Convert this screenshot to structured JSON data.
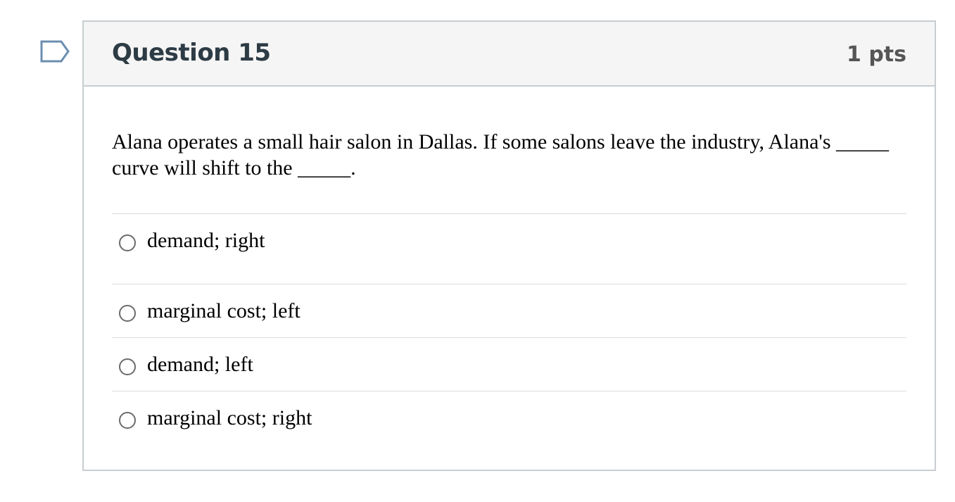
{
  "question": {
    "title": "Question 15",
    "points": "1 pts",
    "text": "Alana operates a small hair salon in Dallas. If some salons leave the industry, Alana's _____ curve will shift to the _____.",
    "flag_icon": "flag-outline-icon",
    "answers": [
      {
        "label": "demand; right",
        "selected": false
      },
      {
        "label": "marginal cost; left",
        "selected": false
      },
      {
        "label": "demand; left",
        "selected": false
      },
      {
        "label": "marginal cost; right",
        "selected": false
      }
    ]
  },
  "colors": {
    "header_background": "#f5f5f5",
    "border": "#c7cdd1",
    "title_text": "#2d3b45",
    "flag": "#6b8eb0"
  }
}
